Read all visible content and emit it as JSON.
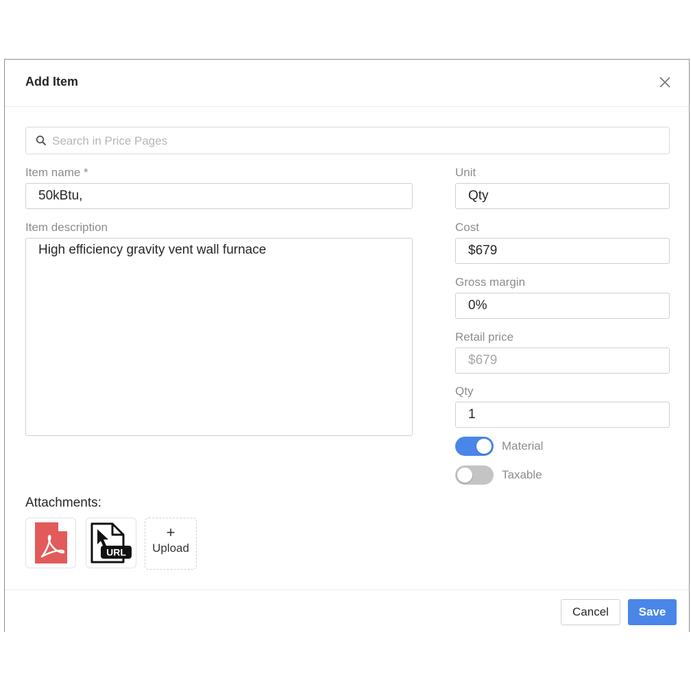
{
  "dialog": {
    "title": "Add Item"
  },
  "search": {
    "placeholder": "Search in Price Pages"
  },
  "form": {
    "item_name_label": "Item name *",
    "item_name_value": "50kBtu,",
    "item_description_label": "Item description",
    "item_description_value": "High efficiency gravity vent wall furnace",
    "unit_label": "Unit",
    "unit_value": "Qty",
    "cost_label": "Cost",
    "cost_value": "$679",
    "gross_margin_label": "Gross margin",
    "gross_margin_value": "0%",
    "retail_price_label": "Retail price",
    "retail_price_value": "$679",
    "qty_label": "Qty",
    "qty_value": "1"
  },
  "toggles": {
    "material_label": "Material",
    "material_on": true,
    "taxable_label": "Taxable",
    "taxable_on": false
  },
  "attachments": {
    "title": "Attachments:",
    "items": [
      {
        "type": "pdf",
        "icon": "pdf-file-icon"
      },
      {
        "type": "url",
        "icon": "url-file-icon",
        "badge": "URL"
      }
    ],
    "upload_plus": "+",
    "upload_label": "Upload"
  },
  "footer": {
    "cancel_label": "Cancel",
    "save_label": "Save"
  },
  "colors": {
    "accent": "#4a86e8",
    "pdf_red": "#e25a5a",
    "toggle_off": "#c4c4c4"
  }
}
